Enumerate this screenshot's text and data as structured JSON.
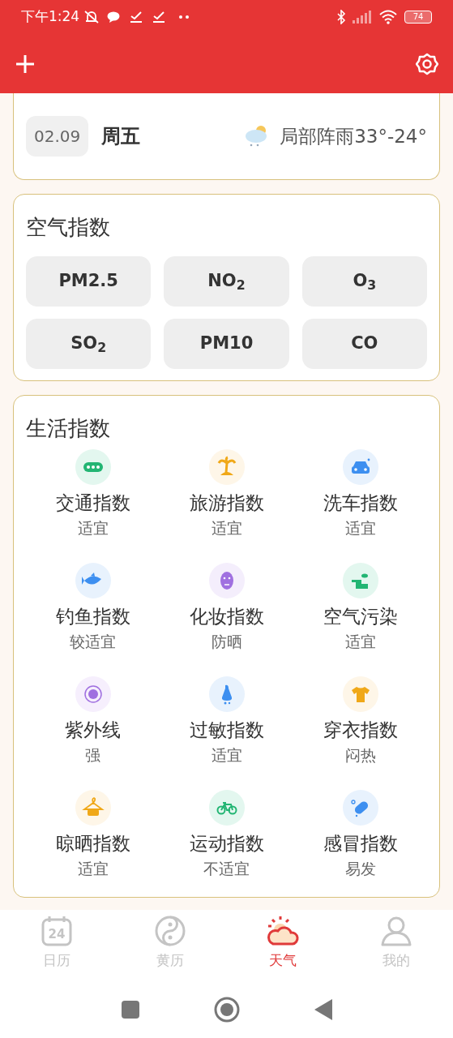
{
  "status_bar": {
    "time": "下午1:24",
    "battery": "74"
  },
  "day_card": {
    "date": "02.09",
    "weekday": "周五",
    "weather": "局部阵雨33°-24°"
  },
  "air_index": {
    "title": "空气指数",
    "items": [
      "PM2.5",
      "NO$_{2}$",
      "O$_{3}$",
      "SO$_{2}$",
      "PM10",
      "CO"
    ]
  },
  "life_index": {
    "title": "生活指数",
    "items": [
      {
        "kind": "traffic",
        "label": "交通指数",
        "value": "适宜"
      },
      {
        "kind": "travel",
        "label": "旅游指数",
        "value": "适宜"
      },
      {
        "kind": "carwash",
        "label": "洗车指数",
        "value": "适宜"
      },
      {
        "kind": "fishing",
        "label": "钓鱼指数",
        "value": "较适宜"
      },
      {
        "kind": "makeup",
        "label": "化妆指数",
        "value": "防晒"
      },
      {
        "kind": "pollution",
        "label": "空气污染",
        "value": "适宜"
      },
      {
        "kind": "uv",
        "label": "紫外线",
        "value": "强"
      },
      {
        "kind": "allergy",
        "label": "过敏指数",
        "value": "适宜"
      },
      {
        "kind": "clothing",
        "label": "穿衣指数",
        "value": "闷热"
      },
      {
        "kind": "drying",
        "label": "晾晒指数",
        "value": "适宜"
      },
      {
        "kind": "sport",
        "label": "运动指数",
        "value": "不适宜"
      },
      {
        "kind": "cold",
        "label": "感冒指数",
        "value": "易发"
      }
    ]
  },
  "tabs": [
    {
      "kind": "calendar",
      "label": "日历",
      "icon_text": "24",
      "selected": false
    },
    {
      "kind": "almanac",
      "label": "黄历",
      "selected": false
    },
    {
      "kind": "weather",
      "label": "天气",
      "selected": true
    },
    {
      "kind": "me",
      "label": "我的",
      "selected": false
    }
  ]
}
